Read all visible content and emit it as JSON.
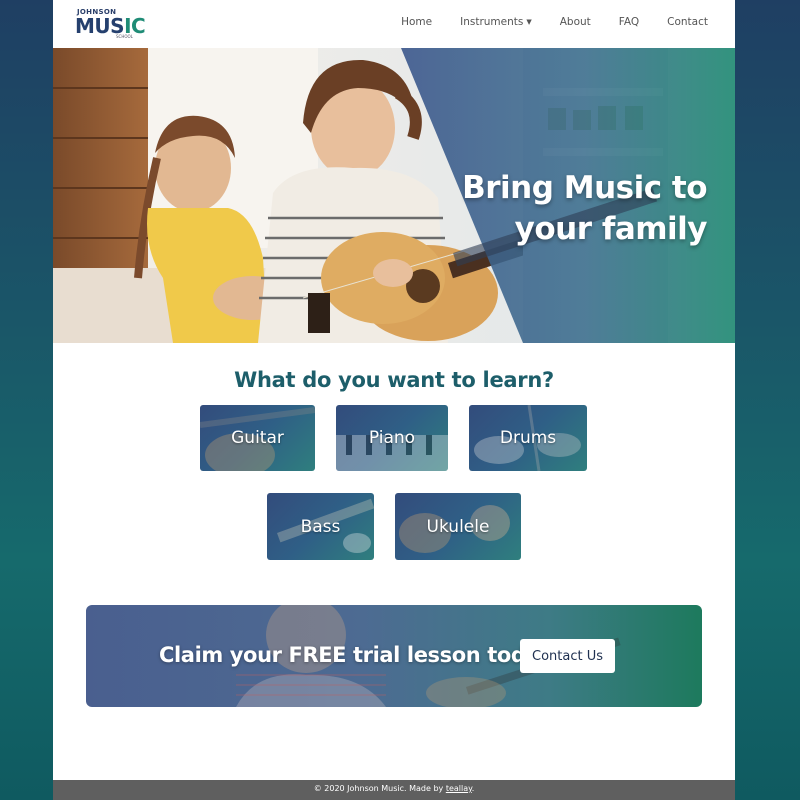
{
  "logo": {
    "top": "JOHNSON",
    "main_a": "MU",
    "main_b": "S",
    "main_c": "IC",
    "sub": "SCHOOL"
  },
  "nav": {
    "items": [
      {
        "label": "Home"
      },
      {
        "label": "Instruments",
        "has_dropdown": true
      },
      {
        "label": "About"
      },
      {
        "label": "FAQ"
      },
      {
        "label": "Contact"
      }
    ]
  },
  "hero": {
    "line1": "Bring Music to",
    "line2": "your family"
  },
  "learn": {
    "title": "What do you want to learn?",
    "instruments": [
      {
        "label": "Guitar"
      },
      {
        "label": "Piano"
      },
      {
        "label": "Drums"
      },
      {
        "label": "Bass"
      },
      {
        "label": "Ukulele"
      }
    ]
  },
  "cta": {
    "text": "Claim your FREE trial lesson today!",
    "button": "Contact Us"
  },
  "footer": {
    "prefix": "© 2020 Johnson Music. Made by ",
    "link": "teallay",
    "suffix": "."
  },
  "colors": {
    "heading": "#1d5e6a",
    "brand_blue": "#25406e",
    "brand_green": "#1f8c76",
    "footer_bg": "#5f5f5f"
  }
}
